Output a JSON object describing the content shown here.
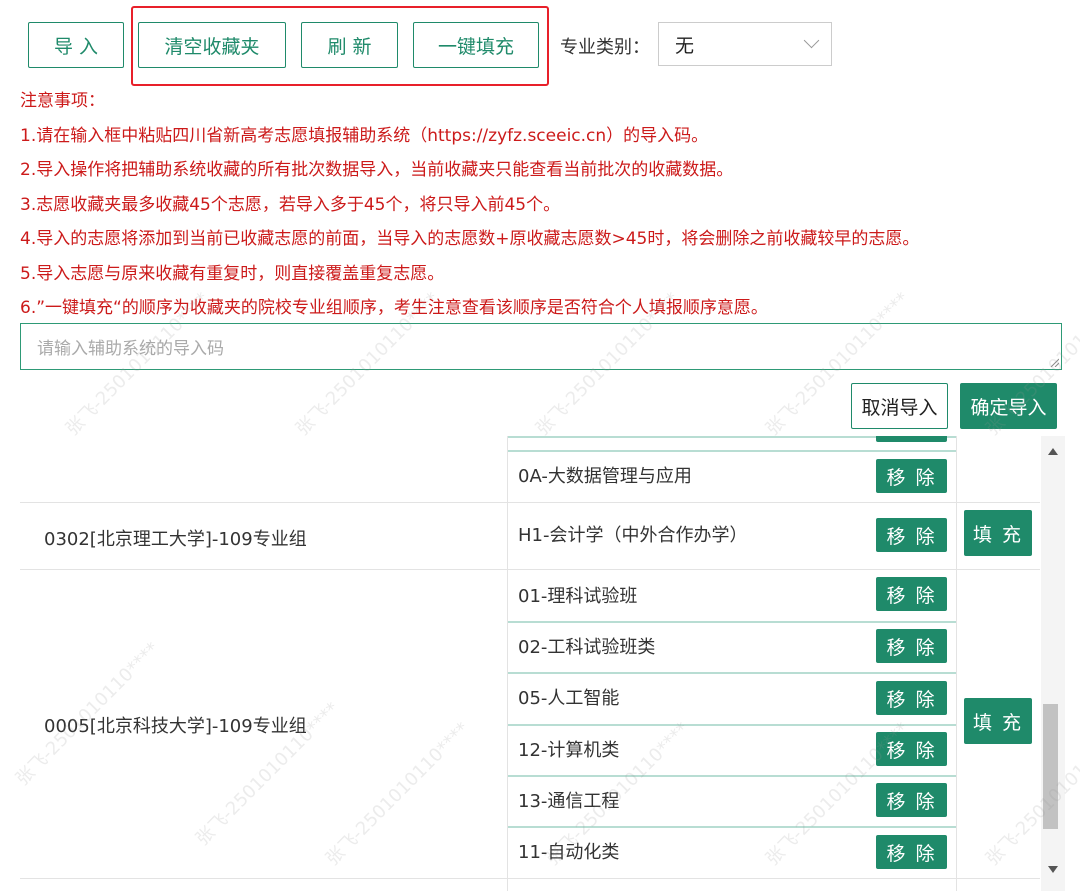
{
  "toolbar": {
    "import_label": "导 入",
    "clear_label": "清空收藏夹",
    "refresh_label": "刷 新",
    "autofill_label": "一键填充",
    "category_label": "专业类别：",
    "category_value": "无"
  },
  "notes": {
    "title": "注意事项：",
    "items": [
      "1.请在输入框中粘贴四川省新高考志愿填报辅助系统（https://zyfz.sceeic.cn）的导入码。",
      "2.导入操作将把辅助系统收藏的所有批次数据导入，当前收藏夹只能查看当前批次的收藏数据。",
      "3.志愿收藏夹最多收藏45个志愿，若导入多于45个，将只导入前45个。",
      "4.导入的志愿将添加到当前已收藏志愿的前面，当导入的志愿数+原收藏志愿数>45时，将会删除之前收藏较早的志愿。",
      "5.导入志愿与原来收藏有重复时，则直接覆盖重复志愿。",
      "6.”一键填充“的顺序为收藏夹的院校专业组顺序，考生注意查看该顺序是否符合个人填报顺序意愿。"
    ]
  },
  "import": {
    "placeholder": "请输入辅助系统的导入码",
    "cancel_label": "取消导入",
    "confirm_label": "确定导入"
  },
  "table": {
    "remove_label": "移 除",
    "fill_label": "填 充",
    "rows": [
      {
        "group": "",
        "majors": [
          "0A-大数据管理与应用"
        ]
      },
      {
        "group": "0302[北京理工大学]-109专业组",
        "majors": [
          "H1-会计学（中外合作办学）"
        ]
      },
      {
        "group": "0005[北京科技大学]-109专业组",
        "majors": [
          "01-理科试验班",
          "02-工科试验班类",
          "05-人工智能",
          "12-计算机类",
          "13-通信工程",
          "11-自动化类"
        ]
      }
    ]
  },
  "watermark": "张飞-2501010110****",
  "colors": {
    "accent": "#1f8a6a",
    "warning_text": "#cc1a1a",
    "highlight_box": "#e8202a"
  }
}
